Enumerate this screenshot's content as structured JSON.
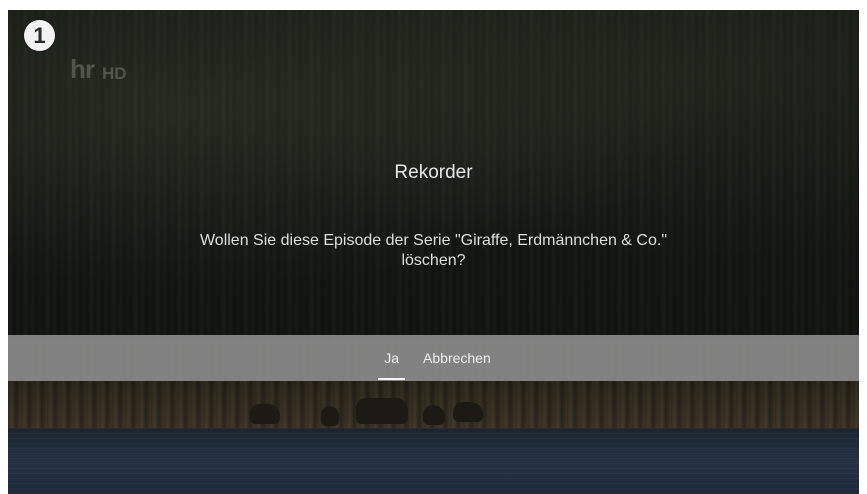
{
  "step_badge": "1",
  "channel": {
    "logo_text": "hr",
    "quality": "HD"
  },
  "dialog": {
    "title": "Rekorder",
    "message": "Wollen Sie diese Episode der Serie \"Giraffe, Erdmännchen & Co.\"\nlöschen?",
    "actions": [
      {
        "label": "Ja",
        "selected": true
      },
      {
        "label": "Abbrechen",
        "selected": false
      }
    ]
  }
}
